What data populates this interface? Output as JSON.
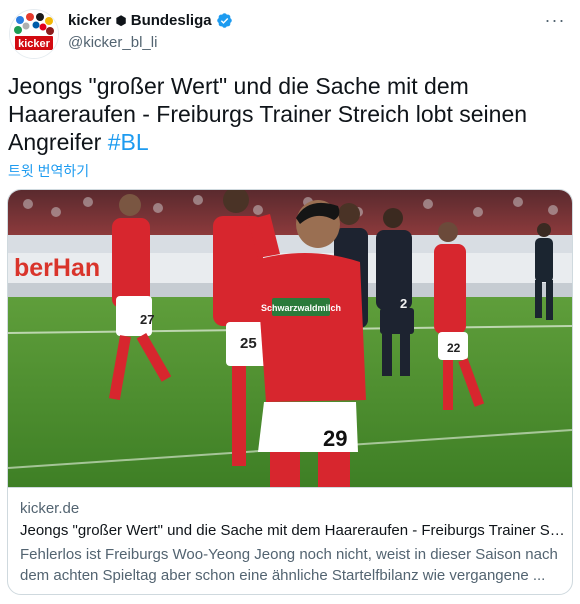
{
  "header": {
    "display_name": "kicker",
    "separator_glyph": "⬢",
    "display_name_suffix": "Bundesliga",
    "handle": "@kicker_bl_li",
    "avatar_label": "kicker",
    "more_label": "···"
  },
  "tweet": {
    "text": "Jeongs \"großer Wert\" und die Sache mit dem Haareraufen - Freiburgs Trainer Streich lobt seinen Angreifer ",
    "hashtag": "#BL",
    "translate_label": "트윗 번역하기"
  },
  "card": {
    "domain": "kicker.de",
    "title": "Jeongs \"großer Wert\" und die Sache mit dem Haareraufen - Freiburgs Trainer Streich lobt seinen Angreifer",
    "description": "Fehlerlos ist Freiburgs Woo-Yeong Jeong noch nicht, weist in dieser Saison nach dem achten Spieltag aber schon eine ähnliche Startelfbilanz wie vergangene ...",
    "photo": {
      "board_text": "berHan",
      "jersey_numbers": [
        "27",
        "25",
        "29",
        "22",
        "2"
      ],
      "sponsor_text": "Schwarzwaldmilch"
    }
  },
  "colors": {
    "accent": "#1d9bf0",
    "text_primary": "#0f1419",
    "text_secondary": "#536471",
    "border": "#cfd9de",
    "kicker_red": "#d20a11"
  }
}
